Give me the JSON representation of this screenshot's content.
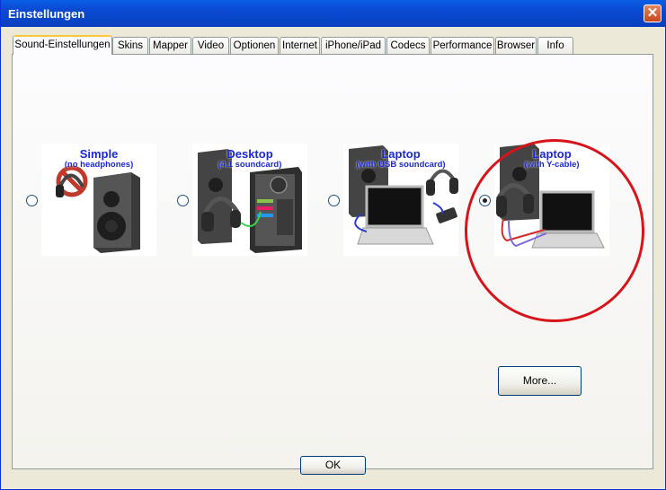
{
  "window": {
    "title": "Einstellungen",
    "close_glyph": "✕"
  },
  "tabs": [
    {
      "label": "Sound-Einstellungen",
      "active": true
    },
    {
      "label": "Skins"
    },
    {
      "label": "Mapper"
    },
    {
      "label": "Video"
    },
    {
      "label": "Optionen"
    },
    {
      "label": "Internet"
    },
    {
      "label": "iPhone/iPad"
    },
    {
      "label": "Codecs"
    },
    {
      "label": "Performance"
    },
    {
      "label": "Browser"
    },
    {
      "label": "Info"
    }
  ],
  "options": [
    {
      "title": "Simple",
      "subtitle": "(no headphones)",
      "selected": false,
      "image": "speaker-no-headphones"
    },
    {
      "title": "Desktop",
      "subtitle": "(4.1 soundcard)",
      "selected": false,
      "image": "speaker-pc-tower-headphones"
    },
    {
      "title": "Laptop",
      "subtitle": "(with USB soundcard)",
      "selected": false,
      "image": "speaker-laptop-usb-headphones"
    },
    {
      "title": "Laptop",
      "subtitle": "(with Y-cable)",
      "selected": true,
      "image": "speaker-laptop-ycable-headphones"
    }
  ],
  "buttons": {
    "more": "More...",
    "ok": "OK"
  },
  "colors": {
    "title_bar": "#0a4ad3",
    "option_text": "#1b28d6",
    "highlight_circle": "#d8141a",
    "tab_active_accent": "#ffc83c"
  }
}
